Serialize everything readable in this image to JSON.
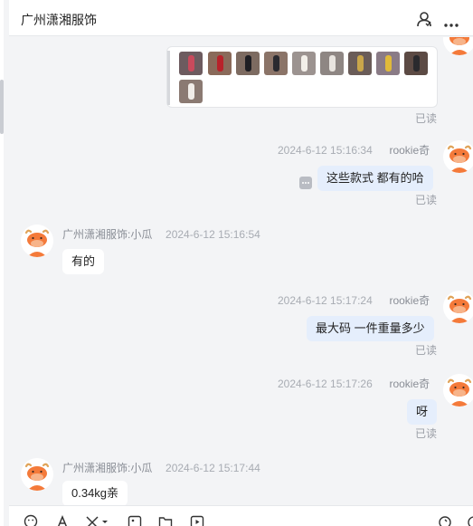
{
  "header": {
    "title": "广州潇湘服饰",
    "icons": [
      "user-icon",
      "more-icon"
    ]
  },
  "messages": [
    {
      "type": "image-grid",
      "side": "mine",
      "image_count": 10,
      "read": "已读"
    },
    {
      "side": "mine",
      "name": "rookie奇",
      "time": "2024-6-12 15:16:34",
      "text": "这些款式 都有的哈",
      "read": "已读"
    },
    {
      "side": "theirs",
      "name": "广州潇湘服饰:小瓜",
      "time": "2024-6-12 15:16:54",
      "text": "有的"
    },
    {
      "side": "mine",
      "name": "rookie奇",
      "time": "2024-6-12 15:17:24",
      "text": "最大码 一件重量多少",
      "read": "已读"
    },
    {
      "side": "mine",
      "name": "rookie奇",
      "time": "2024-6-12 15:17:26",
      "text": "呀",
      "read": "已读"
    },
    {
      "side": "theirs",
      "name": "广州潇湘服饰:小瓜",
      "time": "2024-6-12 15:17:44",
      "text": "0.34kg亲"
    }
  ],
  "toolbar": {
    "icons": [
      "emoji-icon",
      "font-icon",
      "scissors-icon",
      "image-icon",
      "folder-icon",
      "video-icon",
      "refresh-icon"
    ]
  },
  "colors": {
    "mine_bubble": "#e5eefc",
    "theirs_bubble": "#ffffff",
    "chat_background": "#f3f4f6",
    "avatar_orange": "#f47a3a"
  }
}
